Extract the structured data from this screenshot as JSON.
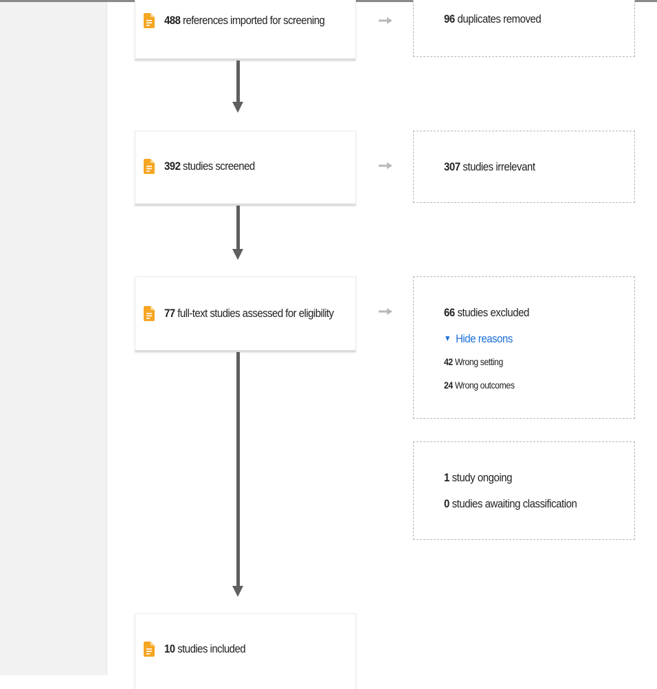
{
  "flow": {
    "stage1": {
      "count": "488",
      "text": "references imported for screening"
    },
    "stage2": {
      "count": "392",
      "text": "studies screened"
    },
    "stage3": {
      "count": "77",
      "text": "full-text studies assessed for eligibility"
    },
    "stage4": {
      "count": "10",
      "text": "studies included"
    }
  },
  "side": {
    "duplicates": {
      "count": "96",
      "text": "duplicates removed"
    },
    "irrelevant": {
      "count": "307",
      "text": "studies irrelevant"
    },
    "excluded": {
      "count": "66",
      "text": "studies excluded",
      "toggle_label": "Hide reasons",
      "reasons": [
        {
          "count": "42",
          "text": "Wrong setting"
        },
        {
          "count": "24",
          "text": "Wrong outcomes"
        }
      ]
    },
    "other": {
      "ongoing": {
        "count": "1",
        "text": "study ongoing"
      },
      "awaiting": {
        "count": "0",
        "text": "studies awaiting classification"
      }
    }
  },
  "icons": {
    "document": "document-icon",
    "right_arrow": "arrow-right-icon",
    "toggle": "triangle-down-icon"
  },
  "colors": {
    "icon_orange": "#f5a623",
    "link_blue": "#1a6fd9",
    "connector": "#5f5f5f",
    "sidebar": "#f2f2f2"
  }
}
